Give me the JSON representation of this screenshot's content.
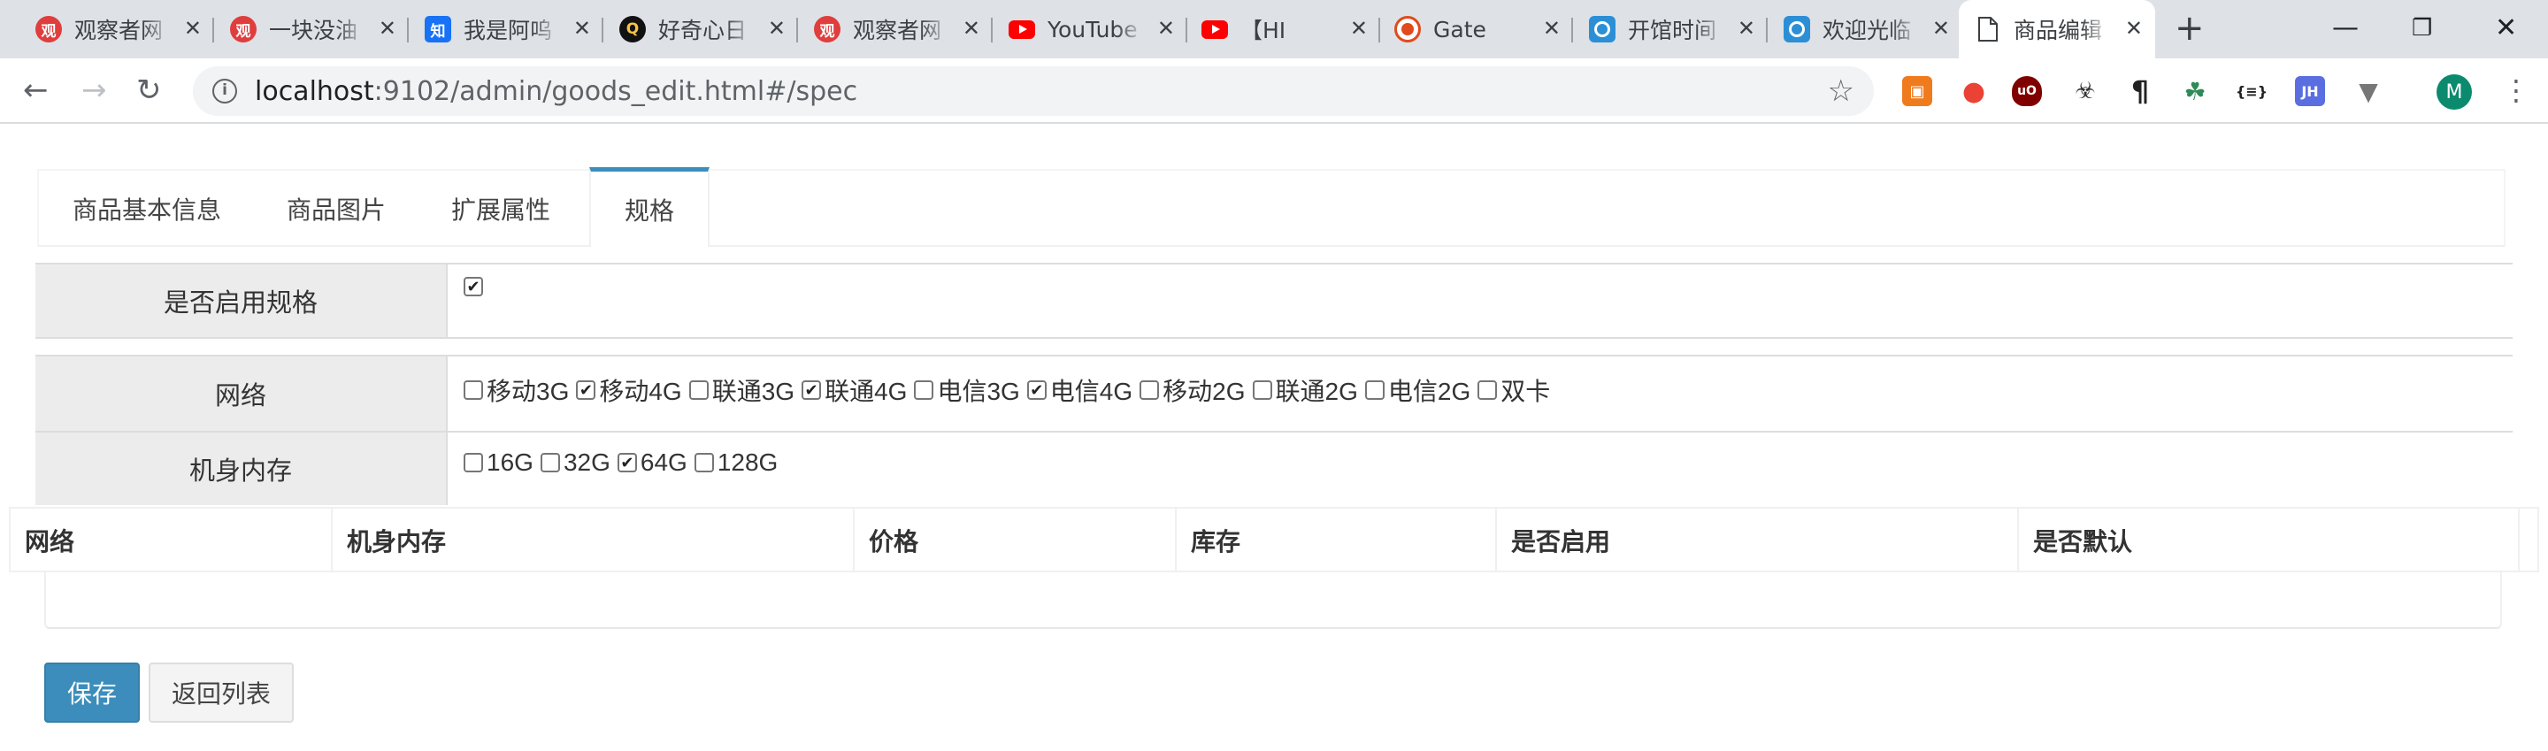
{
  "browser": {
    "tabs": [
      {
        "title": "观察者网",
        "favicon": "guan-icon",
        "glyph": "观"
      },
      {
        "title": "一块没油",
        "favicon": "guan-icon",
        "glyph": "观"
      },
      {
        "title": "我是阿呜",
        "favicon": "zhihu-icon",
        "glyph": "知"
      },
      {
        "title": "好奇心日",
        "favicon": "qdaily-icon",
        "glyph": "Q"
      },
      {
        "title": "观察者网",
        "favicon": "guan-icon",
        "glyph": "观"
      },
      {
        "title": "YouTube",
        "favicon": "youtube-icon",
        "glyph": ""
      },
      {
        "title": "【HI",
        "favicon": "youtube-icon",
        "glyph": ""
      },
      {
        "title": "Gate",
        "favicon": "gate-icon",
        "glyph": ""
      },
      {
        "title": "开馆时间",
        "favicon": "guang-icon",
        "glyph": ""
      },
      {
        "title": "欢迎光临",
        "favicon": "guang-icon",
        "glyph": ""
      },
      {
        "title": "商品编辑",
        "favicon": "document-icon",
        "glyph": "",
        "active": true
      }
    ],
    "new_tab": "+",
    "window_controls": {
      "minimize": "—",
      "restore": "❐",
      "close": "✕"
    },
    "url": {
      "host": "localhost",
      "rest": ":9102/admin/goods_edit.html#/spec"
    },
    "avatar_letter": "M"
  },
  "page": {
    "tabs": [
      "商品基本信息",
      "商品图片",
      "扩展属性",
      "规格"
    ],
    "active_tab": 3,
    "enable_spec": {
      "label": "是否启用规格",
      "checked": true
    },
    "specs": [
      {
        "label": "网络",
        "options": [
          {
            "text": "移动3G",
            "checked": false
          },
          {
            "text": "移动4G",
            "checked": true
          },
          {
            "text": "联通3G",
            "checked": false
          },
          {
            "text": "联通4G",
            "checked": true
          },
          {
            "text": "电信3G",
            "checked": false
          },
          {
            "text": "电信4G",
            "checked": true
          },
          {
            "text": "移动2G",
            "checked": false
          },
          {
            "text": "联通2G",
            "checked": false
          },
          {
            "text": "电信2G",
            "checked": false
          },
          {
            "text": "双卡",
            "checked": false
          }
        ]
      },
      {
        "label": "机身内存",
        "options": [
          {
            "text": "16G",
            "checked": false
          },
          {
            "text": "32G",
            "checked": false
          },
          {
            "text": "64G",
            "checked": true
          },
          {
            "text": "128G",
            "checked": false
          }
        ]
      }
    ],
    "sku_table": {
      "columns": [
        "网络",
        "机身内存",
        "价格",
        "库存",
        "是否启用",
        "是否默认"
      ]
    },
    "buttons": {
      "save": "保存",
      "back": "返回列表"
    }
  }
}
